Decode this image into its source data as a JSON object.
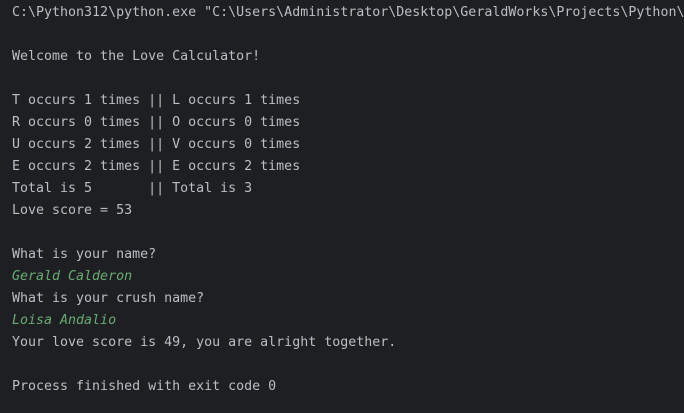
{
  "console": {
    "command": "C:\\Python312\\python.exe \"C:\\Users\\Administrator\\Desktop\\GeraldWorks\\Projects\\Python\\",
    "welcome": "Welcome to the Love Calculator!",
    "counts": [
      "T occurs 1 times || L occurs 1 times",
      "R occurs 0 times || O occurs 0 times",
      "U occurs 2 times || V occurs 0 times",
      "E occurs 2 times || E occurs 2 times",
      "Total is 5       || Total is 3",
      "Love score = 53"
    ],
    "prompt_name": "What is your name?",
    "input_name": "Gerald Calderon",
    "prompt_crush": "What is your crush name?",
    "input_crush": "Loisa Andalio",
    "result": "Your love score is 49, you are alright together.",
    "exit": "Process finished with exit code 0"
  },
  "colors": {
    "background": "#1e1f22",
    "output_text": "#bcbec4",
    "user_input": "#6aab73"
  }
}
